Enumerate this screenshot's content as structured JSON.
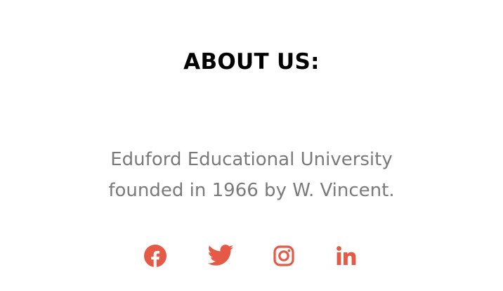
{
  "about": {
    "title": "ABOUT US:",
    "description": "Eduford Educational University founded in 1966 by W. Vincent."
  },
  "social": {
    "accent_color": "#e55a46",
    "items": [
      {
        "icon": "facebook-icon"
      },
      {
        "icon": "twitter-icon"
      },
      {
        "icon": "instagram-icon"
      },
      {
        "icon": "linkedin-icon"
      }
    ]
  }
}
